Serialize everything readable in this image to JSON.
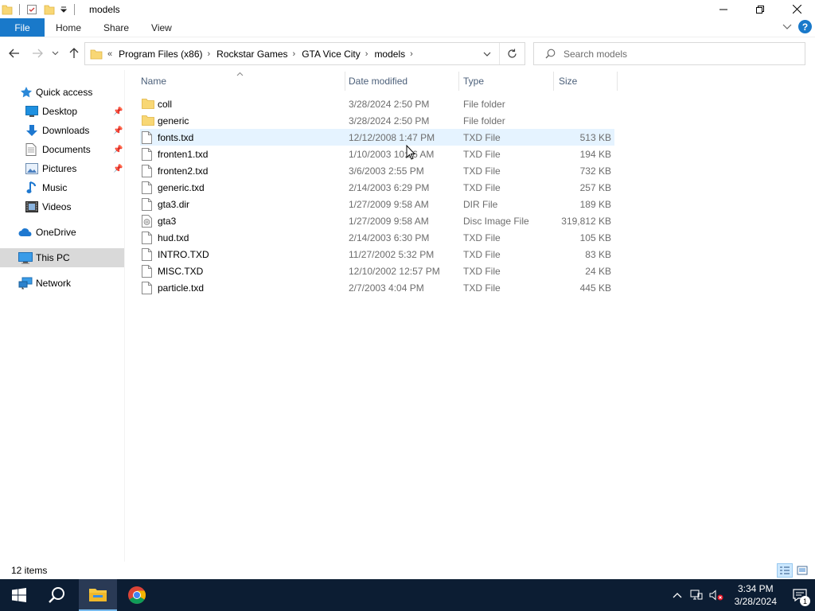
{
  "window": {
    "title": "models"
  },
  "ribbon": {
    "file": "File",
    "home": "Home",
    "share": "Share",
    "view": "View"
  },
  "address": {
    "overflow": "«",
    "crumbs": [
      "Program Files (x86)",
      "Rockstar Games",
      "GTA Vice City",
      "models"
    ]
  },
  "search": {
    "placeholder": "Search models"
  },
  "sidebar": {
    "quick_access": "Quick access",
    "desktop": "Desktop",
    "downloads": "Downloads",
    "documents": "Documents",
    "pictures": "Pictures",
    "music": "Music",
    "videos": "Videos",
    "onedrive": "OneDrive",
    "this_pc": "This PC",
    "network": "Network"
  },
  "columns": {
    "name": "Name",
    "date": "Date modified",
    "type": "Type",
    "size": "Size"
  },
  "files": [
    {
      "name": "coll",
      "date": "3/28/2024 2:50 PM",
      "type": "File folder",
      "size": "",
      "icon": "folder-icon"
    },
    {
      "name": "generic",
      "date": "3/28/2024 2:50 PM",
      "type": "File folder",
      "size": "",
      "icon": "folder-icon"
    },
    {
      "name": "fonts.txd",
      "date": "12/12/2008 1:47 PM",
      "type": "TXD File",
      "size": "513 KB",
      "icon": "file-icon"
    },
    {
      "name": "fronten1.txd",
      "date": "1/10/2003 10:36 AM",
      "type": "TXD File",
      "size": "194 KB",
      "icon": "file-icon"
    },
    {
      "name": "fronten2.txd",
      "date": "3/6/2003 2:55 PM",
      "type": "TXD File",
      "size": "732 KB",
      "icon": "file-icon"
    },
    {
      "name": "generic.txd",
      "date": "2/14/2003 6:29 PM",
      "type": "TXD File",
      "size": "257 KB",
      "icon": "file-icon"
    },
    {
      "name": "gta3.dir",
      "date": "1/27/2009 9:58 AM",
      "type": "DIR File",
      "size": "189 KB",
      "icon": "file-icon"
    },
    {
      "name": "gta3",
      "date": "1/27/2009 9:58 AM",
      "type": "Disc Image File",
      "size": "319,812 KB",
      "icon": "disc-image-icon"
    },
    {
      "name": "hud.txd",
      "date": "2/14/2003 6:30 PM",
      "type": "TXD File",
      "size": "105 KB",
      "icon": "file-icon"
    },
    {
      "name": "INTRO.TXD",
      "date": "11/27/2002 5:32 PM",
      "type": "TXD File",
      "size": "83 KB",
      "icon": "file-icon"
    },
    {
      "name": "MISC.TXD",
      "date": "12/10/2002 12:57 PM",
      "type": "TXD File",
      "size": "24 KB",
      "icon": "file-icon"
    },
    {
      "name": "particle.txd",
      "date": "2/7/2003 4:04 PM",
      "type": "TXD File",
      "size": "445 KB",
      "icon": "file-icon"
    }
  ],
  "status": {
    "count": "12 items"
  },
  "taskbar": {
    "time": "3:34 PM",
    "date": "3/28/2024",
    "notifications": "1"
  },
  "colors": {
    "accent": "#1979ca",
    "taskbar": "#0c1d33",
    "hover_row": "#e5f3ff",
    "selected_nav": "#d9d9d9"
  }
}
